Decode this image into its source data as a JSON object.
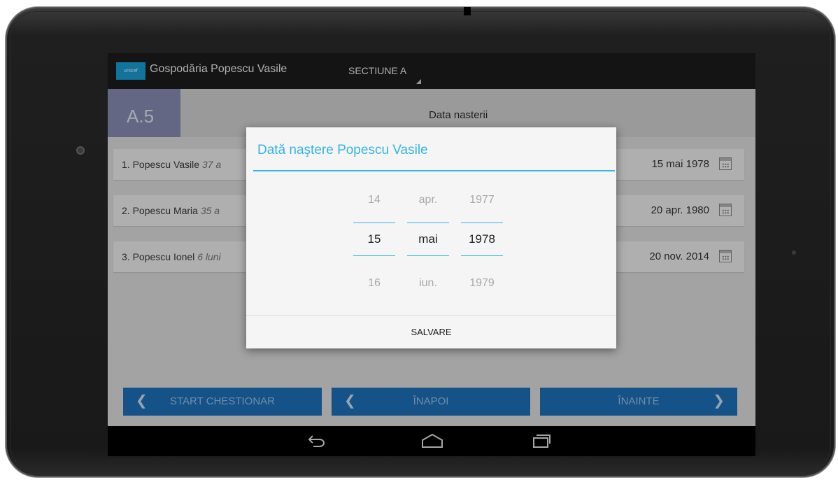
{
  "app": {
    "logo_text": "unicef",
    "title": "Gospodăria Popescu Vasile",
    "section": "SECTIUNE A"
  },
  "question": {
    "code": "A.5",
    "title": "Data nasterii"
  },
  "persons": [
    {
      "name": "1. Popescu Vasile",
      "age": "37 a",
      "date": "15 mai 1978"
    },
    {
      "name": "2. Popescu Maria",
      "age": "35 a",
      "date": "20 apr. 1980"
    },
    {
      "name": "3. Popescu Ionel",
      "age": "6 luni",
      "date": "20 nov. 2014"
    }
  ],
  "navigation": {
    "start": "START CHESTIONAR",
    "back": "ÎNAPOI",
    "next": "ÎNAINTE"
  },
  "dialog": {
    "title": "Dată naştere Popescu Vasile",
    "day": {
      "prev": "14",
      "current": "15",
      "next": "16"
    },
    "month": {
      "prev": "apr.",
      "current": "mai",
      "next": "iun."
    },
    "year": {
      "prev": "1977",
      "current": "1978",
      "next": "1979"
    },
    "save_label": "SALVARE"
  },
  "colors": {
    "accent": "#33b5e5",
    "nav_button": "#1d72bd",
    "question_code_bg": "#8b8fb8"
  },
  "icons": {
    "calendar": "calendar-icon",
    "system_back": "back-arrow-icon",
    "system_home": "home-icon",
    "system_recent": "recent-apps-icon"
  }
}
